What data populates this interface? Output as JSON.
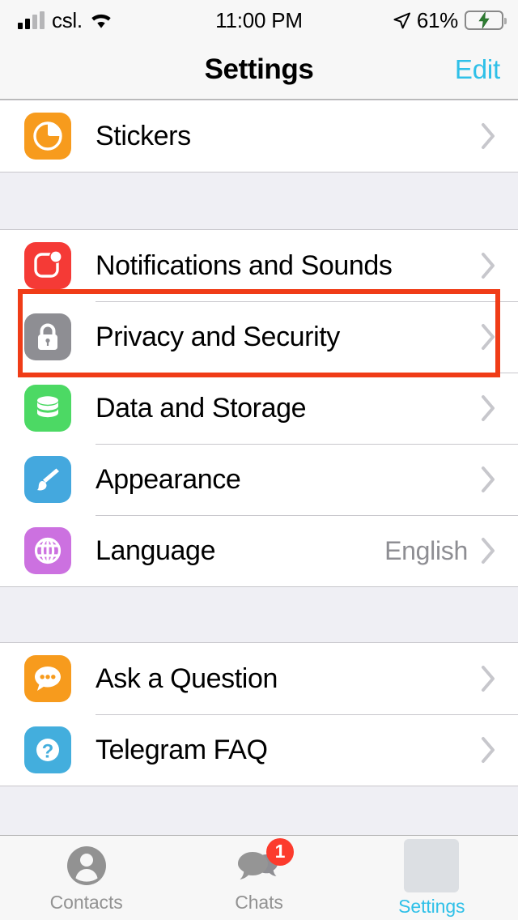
{
  "status_bar": {
    "carrier": "csl.",
    "time": "11:00 PM",
    "battery_percent": "61%",
    "battery_level": 61,
    "charging": true,
    "wifi_icon": "wifi-icon",
    "location_icon": "location-arrow-icon",
    "signal_icon": "cellular-signal-icon"
  },
  "nav": {
    "title": "Settings",
    "edit_label": "Edit"
  },
  "groups": [
    {
      "id": "group-stickers",
      "rows": [
        {
          "id": "stickers",
          "label": "Stickers",
          "icon": "stickers-icon",
          "icon_color": "#F79B1D",
          "value": "",
          "accessory": "chevron-right-icon"
        }
      ]
    },
    {
      "id": "group-preferences",
      "rows": [
        {
          "id": "notifications-and-sounds",
          "label": "Notifications and Sounds",
          "icon": "notifications-icon",
          "icon_color": "#F53A36",
          "value": "",
          "accessory": "chevron-right-icon"
        },
        {
          "id": "privacy-and-security",
          "label": "Privacy and Security",
          "icon": "lock-icon",
          "icon_color": "#8E8E93",
          "value": "",
          "accessory": "chevron-right-icon",
          "highlighted": true
        },
        {
          "id": "data-and-storage",
          "label": "Data and Storage",
          "icon": "database-icon",
          "icon_color": "#4CD964",
          "value": "",
          "accessory": "chevron-right-icon"
        },
        {
          "id": "appearance",
          "label": "Appearance",
          "icon": "paintbrush-icon",
          "icon_color": "#44A8DE",
          "value": "",
          "accessory": "chevron-right-icon"
        },
        {
          "id": "language",
          "label": "Language",
          "icon": "globe-icon",
          "icon_color": "#C濃",
          "value": "English",
          "accessory": "chevron-right-icon"
        }
      ]
    },
    {
      "id": "group-help",
      "rows": [
        {
          "id": "ask-a-question",
          "label": "Ask a Question",
          "icon": "speech-bubble-dots-icon",
          "icon_color": "#F79B1D",
          "value": "",
          "accessory": "chevron-right-icon"
        },
        {
          "id": "telegram-faq",
          "label": "Telegram FAQ",
          "icon": "question-mark-icon",
          "icon_color": "#43AEDD",
          "value": "",
          "accessory": "chevron-right-icon"
        }
      ]
    }
  ],
  "tab_bar": {
    "tabs": [
      {
        "id": "contacts",
        "label": "Contacts",
        "icon": "person-icon",
        "active": false,
        "badge": ""
      },
      {
        "id": "chats",
        "label": "Chats",
        "icon": "chats-bubbles-icon",
        "active": false,
        "badge": "1"
      },
      {
        "id": "settings",
        "label": "Settings",
        "icon": "settings-placeholder-icon",
        "active": true,
        "badge": ""
      }
    ]
  },
  "annotation": {
    "highlight_target": "privacy-and-security",
    "highlight_color": "#F03C17"
  }
}
